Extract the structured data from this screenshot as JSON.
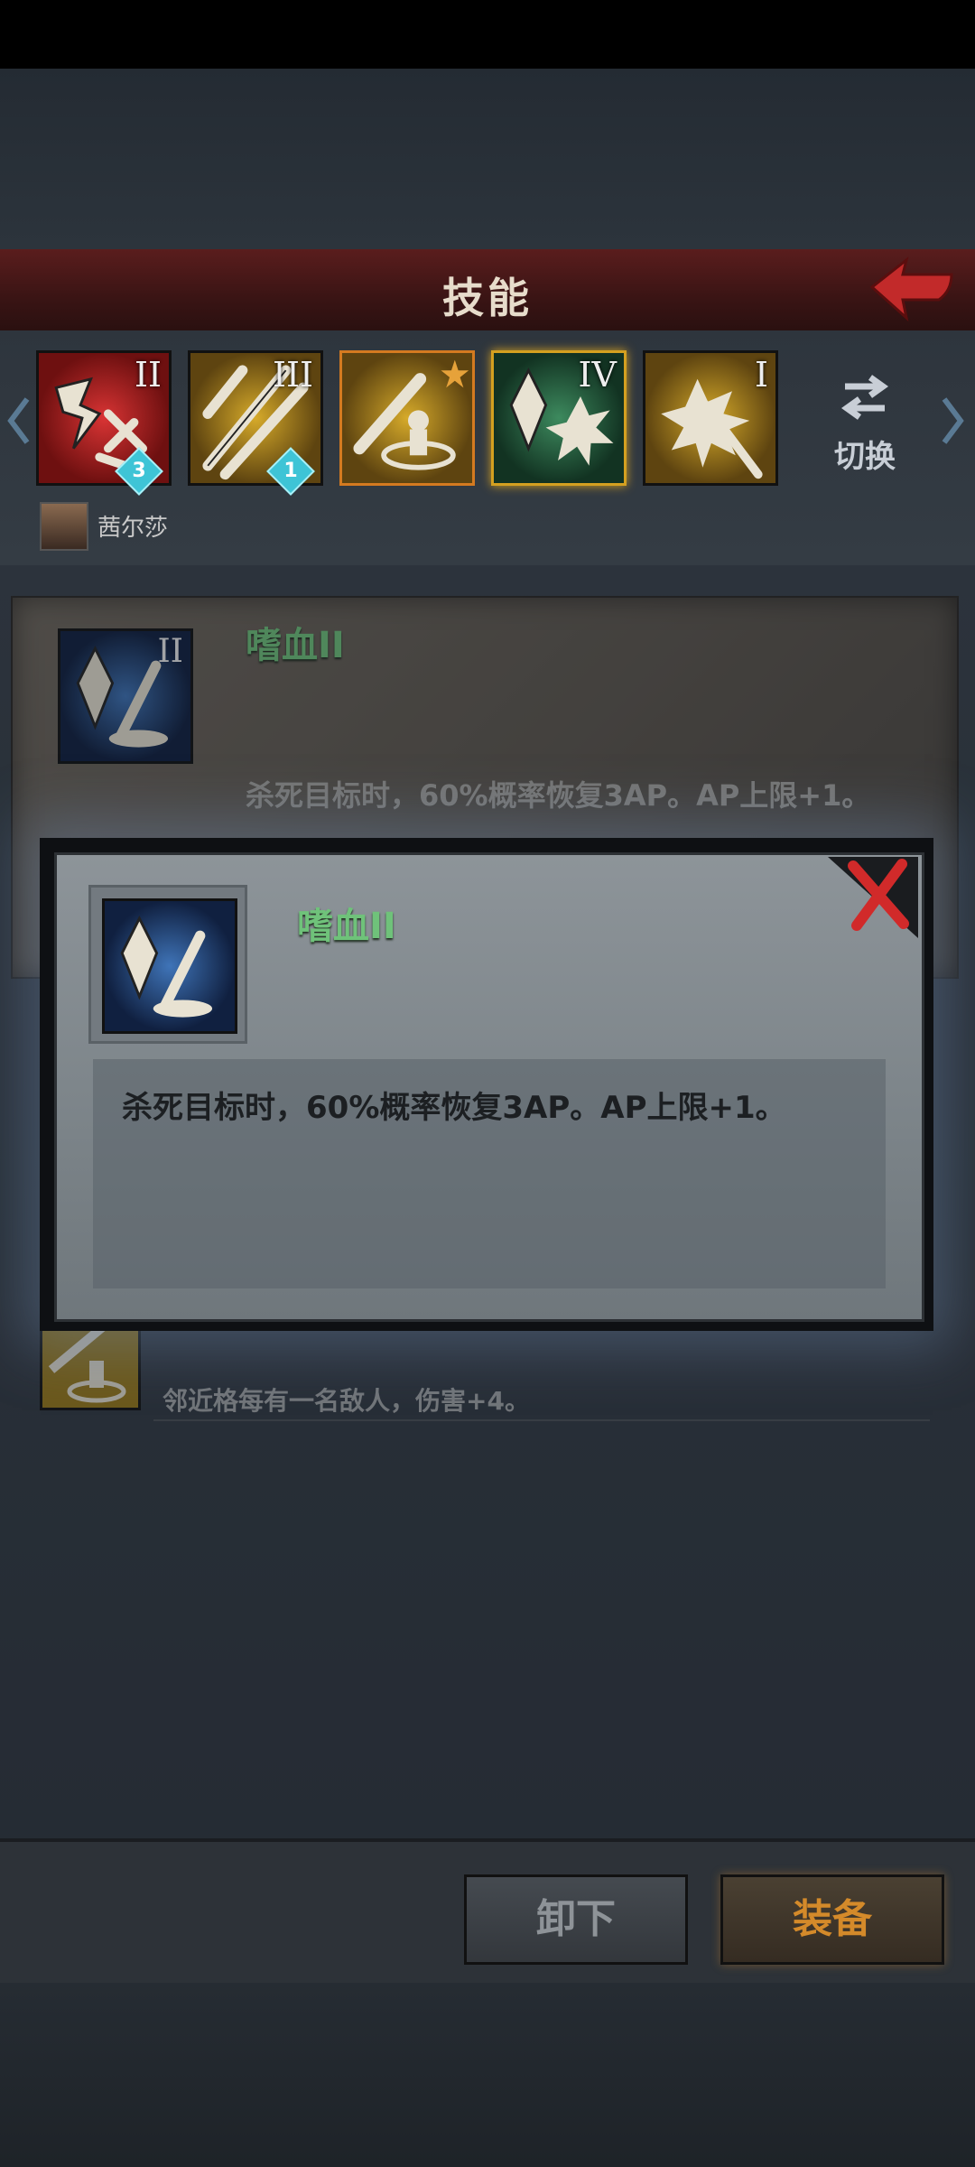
{
  "header": {
    "title": "技能"
  },
  "skills": [
    {
      "rank": "II",
      "badge": "3",
      "colors": {
        "bg": "#b52020",
        "bg2": "#6e1010"
      }
    },
    {
      "rank": "III",
      "badge": "1",
      "colors": {
        "bg": "#b08a1a",
        "bg2": "#6a5010"
      }
    },
    {
      "rank": "",
      "badge": "",
      "colors": {
        "bg": "#b08a1a",
        "bg2": "#6a5010"
      }
    },
    {
      "rank": "IV",
      "badge": "",
      "colors": {
        "bg": "#2d6e48",
        "bg2": "#17402a"
      }
    },
    {
      "rank": "I",
      "badge": "",
      "colors": {
        "bg": "#b08a1a",
        "bg2": "#6a5010"
      }
    }
  ],
  "switch": {
    "label": "切换",
    "icon": "swap-arrows-icon"
  },
  "character": {
    "name": "茜尔莎"
  },
  "list": {
    "row1": {
      "rank": "II",
      "title": "嗜血II",
      "desc": "杀死目标时，60%概率恢复3AP。AP上限+1。"
    },
    "row3": {
      "title": "",
      "desc": "邻近格每有一名敌人，伤害+4。"
    }
  },
  "popup": {
    "title": "嗜血II",
    "desc": "杀死目标时，60%概率恢复3AP。AP上限+1。"
  },
  "buttons": {
    "unequip": "卸下",
    "equip": "装备"
  },
  "colors": {
    "accent_red": "#c22a2a",
    "equip_orange": "#d48a2a",
    "skill_green": "#6fc27a"
  }
}
